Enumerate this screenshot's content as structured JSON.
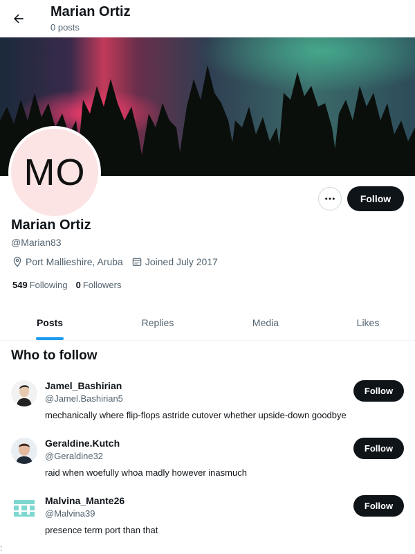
{
  "header": {
    "title": "Marian Ortiz",
    "subtitle": "0 posts",
    "back_icon": "arrow-left-icon"
  },
  "profile": {
    "initials": "MO",
    "display_name": "Marian Ortiz",
    "handle": "@Marian83",
    "location": "Port Mallieshire, Aruba",
    "joined": "Joined July 2017",
    "following_count": "549",
    "following_label": "Following",
    "followers_count": "0",
    "followers_label": "Followers",
    "follow_label": "Follow",
    "more_icon": "more-icon",
    "avatar_bg": "#fce4e4"
  },
  "tabs": [
    {
      "label": "Posts",
      "active": true
    },
    {
      "label": "Replies",
      "active": false
    },
    {
      "label": "Media",
      "active": false
    },
    {
      "label": "Likes",
      "active": false
    }
  ],
  "who_to_follow": {
    "title": "Who to follow",
    "items": [
      {
        "name": "Jamel_Bashirian",
        "handle": "@Jamel.Bashirian5",
        "bio": "mechanically where flip-flops astride cutover whether upside-down goodbye",
        "follow_label": "Follow"
      },
      {
        "name": "Geraldine.Kutch",
        "handle": "@Geraldine32",
        "bio": "raid when woefully whoa madly however inasmuch",
        "follow_label": "Follow"
      },
      {
        "name": "Malvina_Mante26",
        "handle": "@Malvina39",
        "bio": "presence term port than that",
        "follow_label": "Follow"
      }
    ]
  },
  "stray_char": ":",
  "colors": {
    "accent": "#1d9bf0",
    "button": "#0f1419",
    "secondary_text": "#536471"
  }
}
